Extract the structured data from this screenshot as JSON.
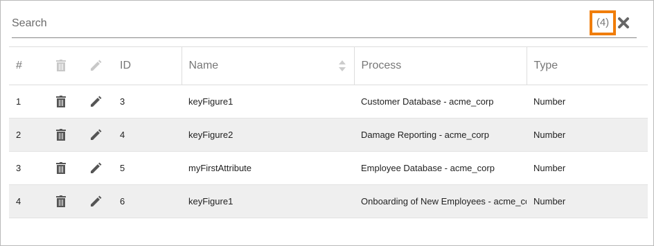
{
  "search": {
    "placeholder": "Search",
    "value": "",
    "result_count": "(4)"
  },
  "table": {
    "columns": {
      "index": "#",
      "id": "ID",
      "name": "Name",
      "process": "Process",
      "type": "Type"
    },
    "rows": [
      {
        "index": "1",
        "id": "3",
        "name": "keyFigure1",
        "process": "Customer Database - acme_corp",
        "type": "Number"
      },
      {
        "index": "2",
        "id": "4",
        "name": "keyFigure2",
        "process": "Damage Reporting - acme_corp",
        "type": "Number"
      },
      {
        "index": "3",
        "id": "5",
        "name": "myFirstAttribute",
        "process": "Employee Database - acme_corp",
        "type": "Number"
      },
      {
        "index": "4",
        "id": "6",
        "name": "keyFigure1",
        "process": "Onboarding of New Employees - acme_corp",
        "type": "Number"
      }
    ]
  },
  "colors": {
    "highlight": "#f07d0a",
    "row_alt": "#efefef",
    "icon": "#555555",
    "icon_disabled": "#c8c8c8"
  },
  "icons": [
    "trash-icon",
    "pencil-icon",
    "close-icon",
    "sort-icon"
  ]
}
